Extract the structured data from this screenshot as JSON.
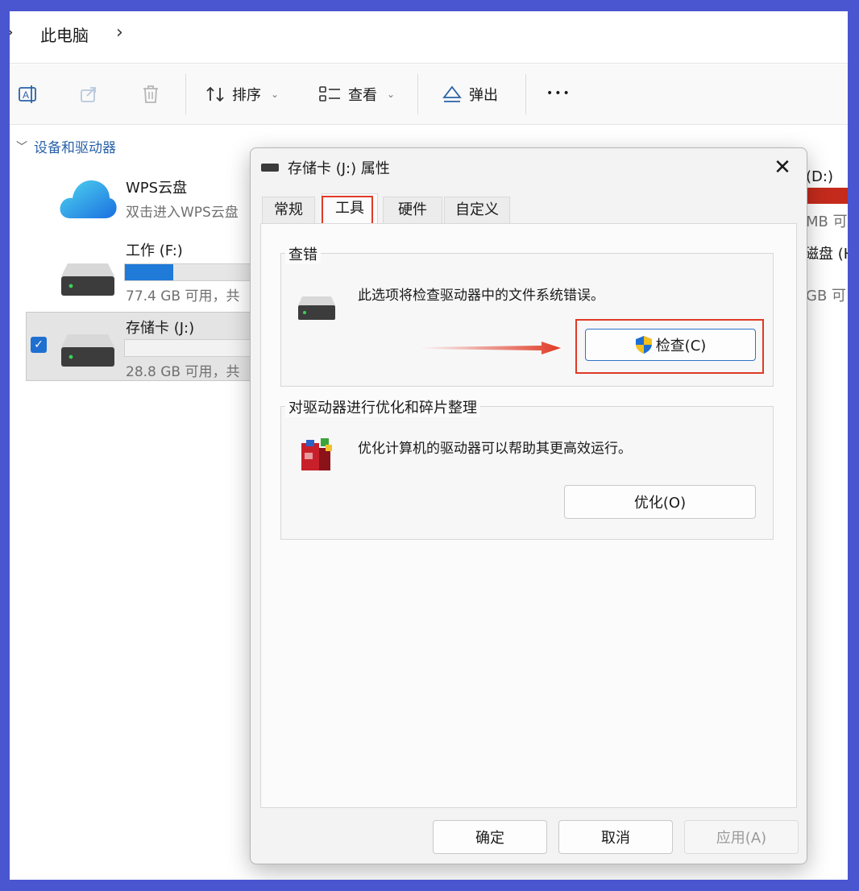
{
  "address": {
    "crumb": "此电脑",
    "chevron_left": "›",
    "chevron_right": "›"
  },
  "toolbar": {
    "sort_label": "排序",
    "view_label": "查看",
    "eject_label": "弹出",
    "more_label": "•••",
    "caret": "⌄"
  },
  "content": {
    "section_title": "设备和驱动器",
    "drives": [
      {
        "name": "WPS云盘",
        "sub": "双击进入WPS云盘"
      },
      {
        "name": "工作 (F:)",
        "sub": "77.4 GB 可用，共",
        "usage": 0.35
      },
      {
        "name": "存储卡 (J:)",
        "sub": "28.8 GB 可用，共",
        "usage": 0.0
      }
    ],
    "right_peek": {
      "d_drive": "(D:)",
      "d_sub": "MB 可",
      "h_drive": "磁盘 (H",
      "h_sub": "GB 可"
    }
  },
  "dialog": {
    "title": "存储卡 (J:) 属性",
    "close": "✕",
    "tabs": [
      "常规",
      "工具",
      "硬件",
      "自定义"
    ],
    "active_tab": "工具",
    "check": {
      "group": "查错",
      "desc": "此选项将检查驱动器中的文件系统错误。",
      "button": "检查(C)"
    },
    "optimize": {
      "group": "对驱动器进行优化和碎片整理",
      "desc": "优化计算机的驱动器可以帮助其更高效运行。",
      "button": "优化(O)"
    },
    "footer": {
      "ok": "确定",
      "cancel": "取消",
      "apply": "应用(A)"
    }
  },
  "colors": {
    "frame": "#4a55d0",
    "highlight": "#e03a26",
    "accent": "#1f7ad8"
  }
}
